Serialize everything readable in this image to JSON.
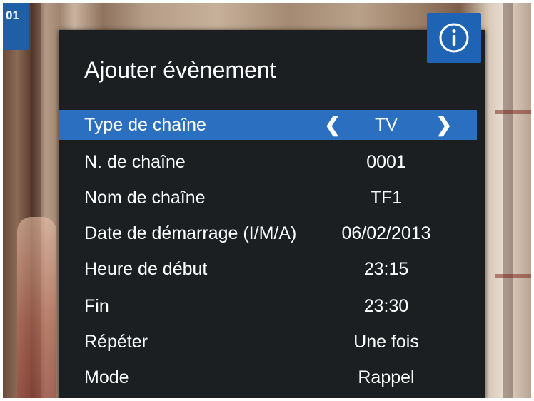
{
  "channel_badge": "01",
  "dialog": {
    "title": "Ajouter évènement",
    "rows": [
      {
        "label": "Type de chaîne",
        "value": "TV",
        "selected": true
      },
      {
        "label": "N. de chaîne",
        "value": "0001"
      },
      {
        "label": "Nom de chaîne",
        "value": "TF1"
      },
      {
        "label": "Date de démarrage (I/M/A)",
        "value": "06/02/2013"
      },
      {
        "label": "Heure de début",
        "value": "23:15"
      },
      {
        "label": "Fin",
        "value": "23:30"
      },
      {
        "label": "Répéter",
        "value": "Une fois"
      },
      {
        "label": "Mode",
        "value": "Rappel"
      }
    ],
    "arrow_left": "❮",
    "arrow_right": "❯"
  },
  "icons": {
    "info": "info-icon",
    "arrow_left": "chevron-left-icon",
    "arrow_right": "chevron-right-icon"
  },
  "colors": {
    "highlight": "#2a6fc0",
    "info_button": "#1f64b4",
    "dialog_bg": "#1b1f22",
    "text": "#ffffff"
  }
}
